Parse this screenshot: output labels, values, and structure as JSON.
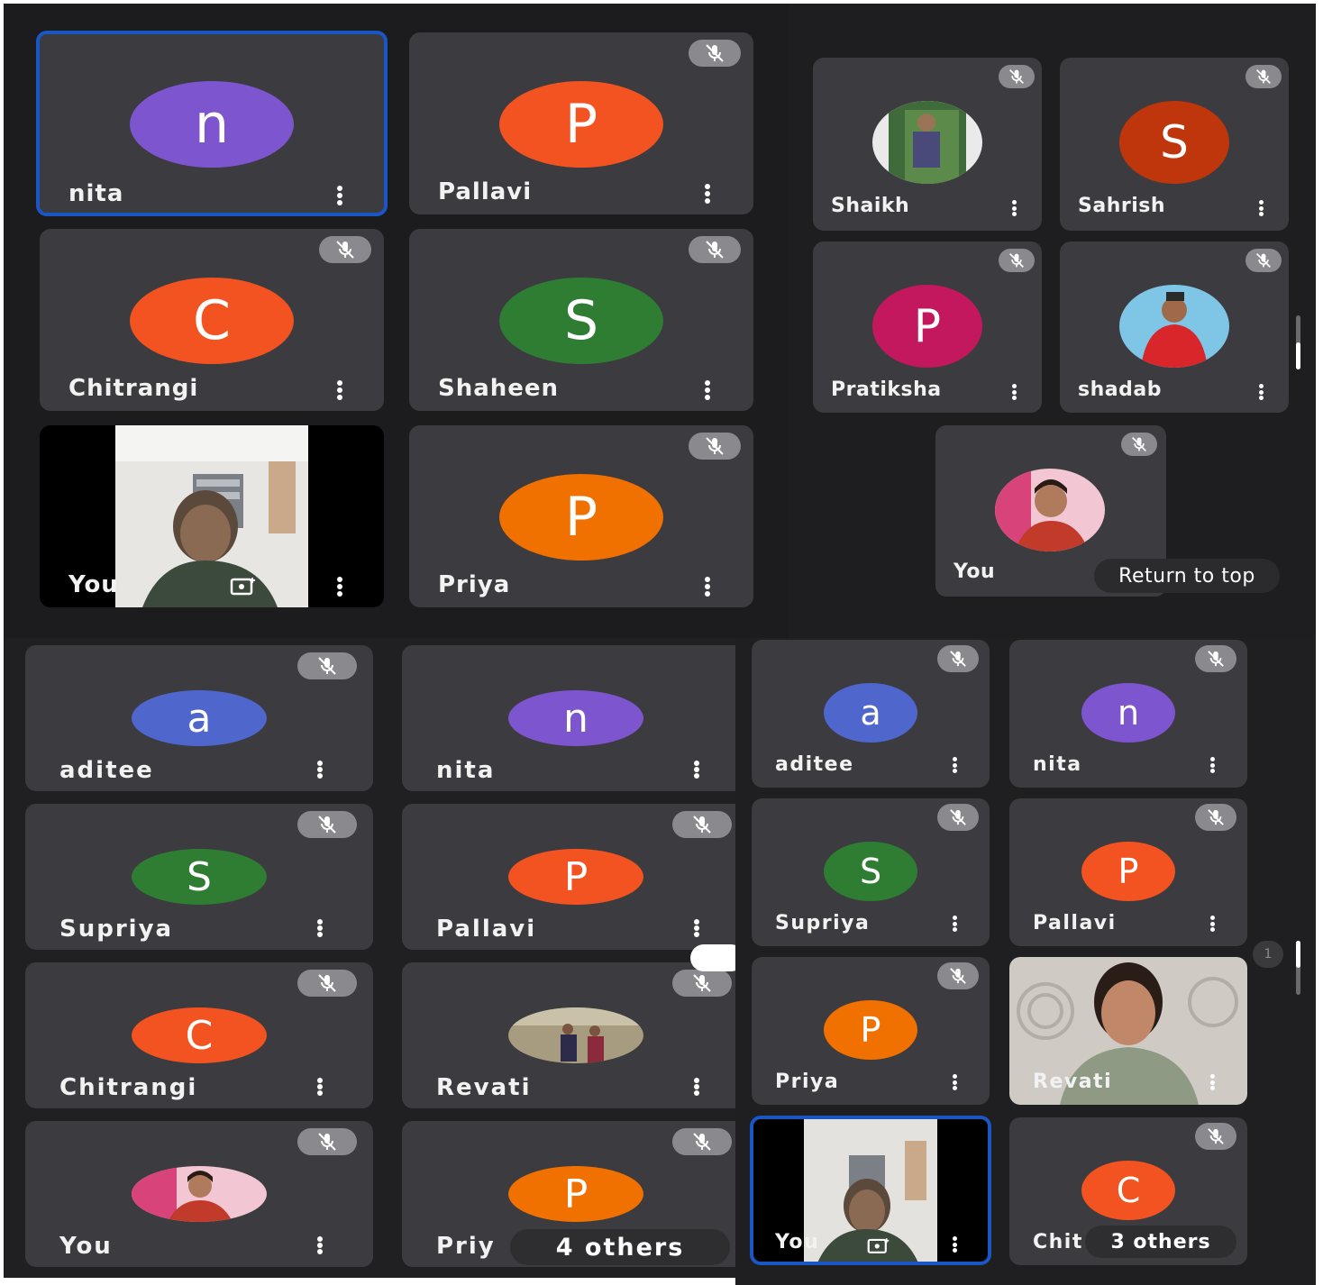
{
  "q1": {
    "tiles": [
      {
        "name": "nita",
        "letter": "n",
        "color": "#7d56cf",
        "muted": false,
        "active": true
      },
      {
        "name": "Pallavi",
        "letter": "P",
        "color": "#f25320",
        "muted": true
      },
      {
        "name": "Chitrangi",
        "letter": "C",
        "color": "#f25320",
        "muted": true
      },
      {
        "name": "Shaheen",
        "letter": "S",
        "color": "#2e7d32",
        "muted": true
      },
      {
        "name": "You",
        "muted": false,
        "video": true
      },
      {
        "name": "Priya",
        "letter": "P",
        "color": "#f07000",
        "muted": true
      }
    ]
  },
  "q2": {
    "tiles": [
      {
        "name": "Shaikh",
        "photo": true,
        "muted": true
      },
      {
        "name": "Sahrish",
        "letter": "S",
        "color": "#c0360c",
        "muted": true
      },
      {
        "name": "Pratiksha",
        "letter": "P",
        "color": "#c3185d",
        "muted": true
      },
      {
        "name": "shadab",
        "photo": true,
        "muted": true
      },
      {
        "name": "You",
        "photo": true,
        "muted": true
      }
    ],
    "return_to_top": "Return to top"
  },
  "q3": {
    "tiles": [
      {
        "name": "aditee",
        "letter": "a",
        "color": "#4f66cc",
        "muted": true
      },
      {
        "name": "nita",
        "letter": "n",
        "color": "#7d56cf",
        "muted": false
      },
      {
        "name": "Supriya",
        "letter": "S",
        "color": "#2e7d32",
        "muted": true
      },
      {
        "name": "Pallavi",
        "letter": "P",
        "color": "#f25320",
        "muted": true
      },
      {
        "name": "Chitrangi",
        "letter": "C",
        "color": "#f25320",
        "muted": true
      },
      {
        "name": "Revati",
        "photo": true,
        "muted": true
      },
      {
        "name": "You",
        "photo": true,
        "muted": true
      },
      {
        "name": "Priy",
        "letter": "P",
        "color": "#f07000",
        "muted": true
      }
    ],
    "others": "4 others"
  },
  "q4": {
    "tiles": [
      {
        "name": "aditee",
        "letter": "a",
        "color": "#4f66cc",
        "muted": true
      },
      {
        "name": "nita",
        "letter": "n",
        "color": "#7d56cf",
        "muted": true
      },
      {
        "name": "Supriya",
        "letter": "S",
        "color": "#2e7d32",
        "muted": true
      },
      {
        "name": "Pallavi",
        "letter": "P",
        "color": "#f25320",
        "muted": true
      },
      {
        "name": "Priya",
        "letter": "P",
        "color": "#f07000",
        "muted": true
      },
      {
        "name": "Revati",
        "muted": false,
        "video": true
      },
      {
        "name": "You",
        "muted": false,
        "video": true,
        "active": true
      },
      {
        "name": "Chit",
        "letter": "C",
        "color": "#f25320",
        "muted": true
      }
    ],
    "others": "3 others",
    "page": "1"
  }
}
